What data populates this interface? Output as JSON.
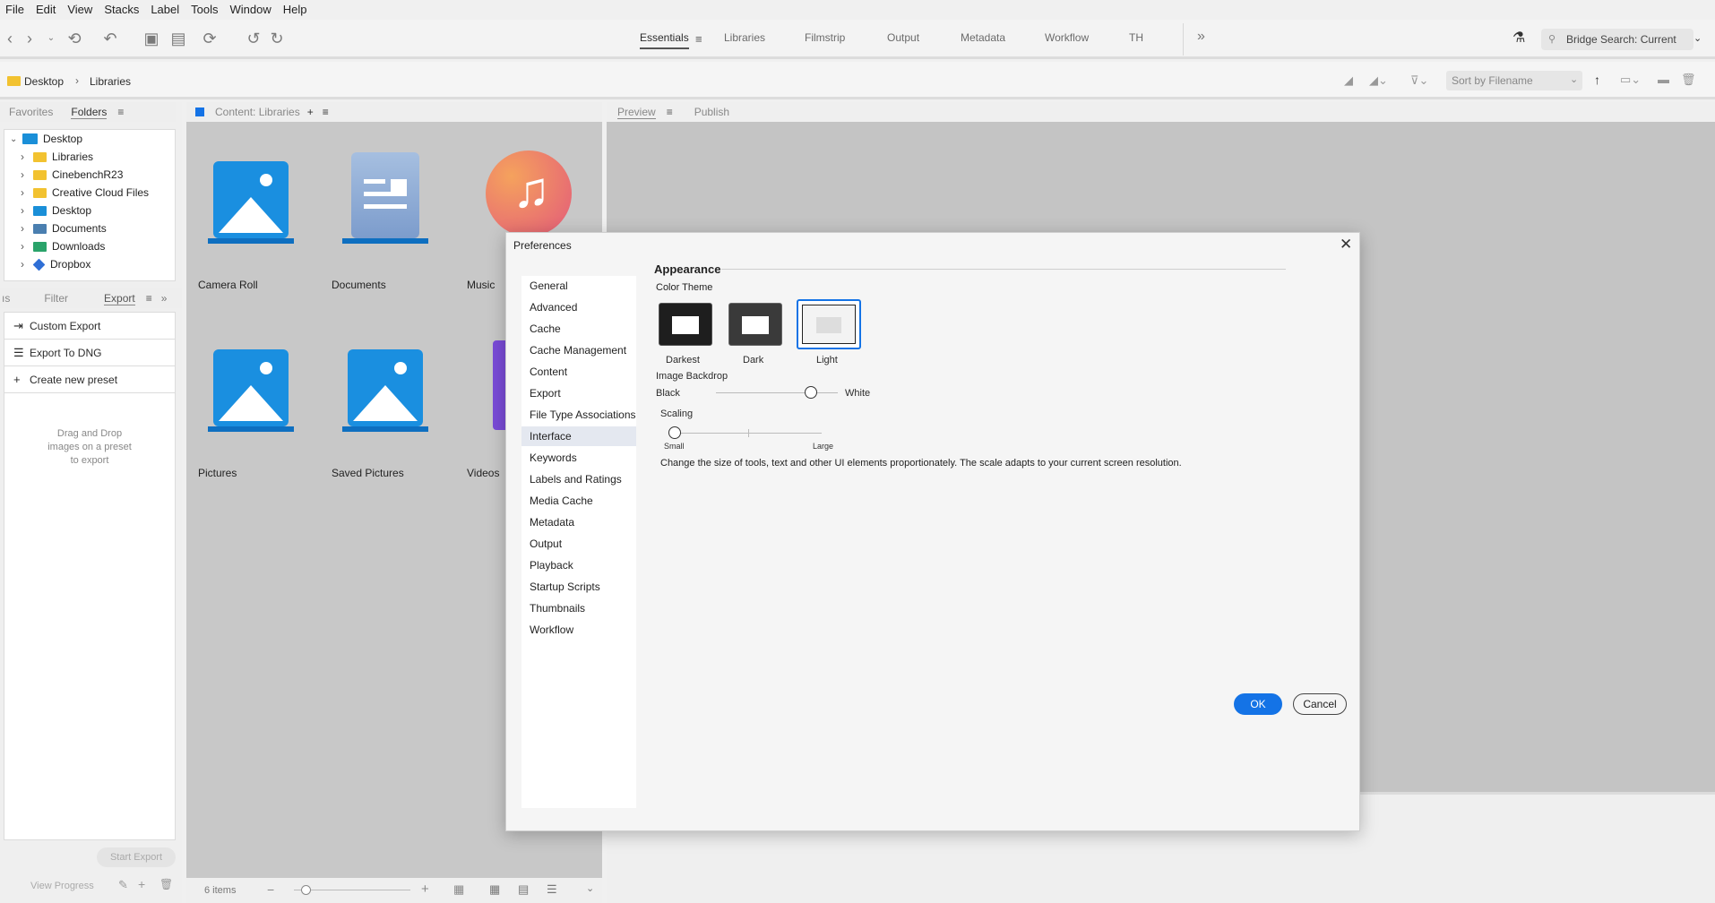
{
  "menubar": [
    "File",
    "Edit",
    "View",
    "Stacks",
    "Label",
    "Tools",
    "Window",
    "Help"
  ],
  "workspaces": {
    "tabs": [
      "Essentials",
      "Libraries",
      "Filmstrip",
      "Output",
      "Metadata",
      "Workflow",
      "TH"
    ],
    "active": "Essentials"
  },
  "search": {
    "placeholder": "Bridge Search: Current"
  },
  "breadcrumb": {
    "items": [
      "Desktop",
      "Libraries"
    ]
  },
  "sort": {
    "label": "Sort by Filename"
  },
  "left_panel": {
    "tabs": [
      "Favorites",
      "Folders"
    ],
    "tree": [
      {
        "label": "Desktop",
        "color": "#1a8fd8"
      },
      {
        "label": "Libraries",
        "color": "#f2c230"
      },
      {
        "label": "CinebenchR23",
        "color": "#f2c230"
      },
      {
        "label": "Creative Cloud Files",
        "color": "#f2c230"
      },
      {
        "label": "Desktop",
        "color": "#1a8fd8"
      },
      {
        "label": "Documents",
        "color": "#4a7fb0"
      },
      {
        "label": "Downloads",
        "color": "#2aa36a"
      },
      {
        "label": "Dropbox",
        "color": "#2f6fd6"
      }
    ]
  },
  "export_panel": {
    "tabs": [
      "Filter",
      "Export"
    ],
    "items": [
      "Custom Export",
      "Export To DNG",
      "Create new preset"
    ],
    "drop_hint": [
      "Drag and Drop",
      "images on a preset",
      "to export"
    ],
    "start_export": "Start Export",
    "view_progress": "View Progress"
  },
  "content": {
    "tab": "Content: Libraries",
    "items": [
      "Camera Roll",
      "Documents",
      "Music",
      "Pictures",
      "Saved Pictures",
      "Videos"
    ],
    "count": "6 items"
  },
  "preview": {
    "tabs": [
      "Preview",
      "Publish"
    ]
  },
  "dialog": {
    "title": "Preferences",
    "nav": [
      "General",
      "Advanced",
      "Cache",
      "Cache Management",
      "Content",
      "Export",
      "File Type Associations",
      "Interface",
      "Keywords",
      "Labels and Ratings",
      "Media Cache",
      "Metadata",
      "Output",
      "Playback",
      "Startup Scripts",
      "Thumbnails",
      "Workflow"
    ],
    "selected": "Interface",
    "section": "Appearance",
    "color_theme_label": "Color Theme",
    "themes": [
      "Darkest",
      "Dark",
      "Light"
    ],
    "selected_theme": "Light",
    "backdrop_label": "Image Backdrop",
    "backdrop_left": "Black",
    "backdrop_right": "White",
    "backdrop_value": 0.78,
    "scaling_label": "Scaling",
    "scaling_small": "Small",
    "scaling_large": "Large",
    "scaling_value": 0.0,
    "scaling_desc": "Change the size of tools, text and other UI elements proportionately. The scale adapts to your current screen resolution.",
    "ok": "OK",
    "cancel": "Cancel"
  },
  "colors": {
    "accent": "#1473e6",
    "panel": "#efefef",
    "content_bg": "#c8c8c8"
  }
}
